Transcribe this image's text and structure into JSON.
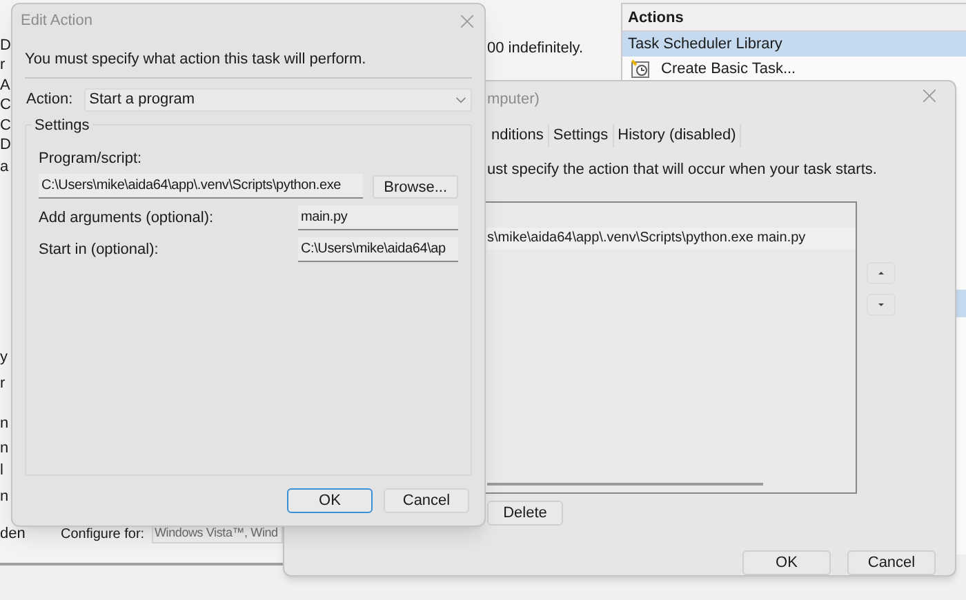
{
  "background_window": {
    "left_fragments": [
      "D",
      "r",
      "A",
      "C",
      "C",
      "D",
      "a",
      "y",
      "r",
      "n",
      "n",
      "l",
      "n"
    ],
    "status_text": "00 indefinitely.",
    "bottom_label": "den",
    "configure_for": {
      "label": "Configure for:",
      "value": "Windows Vista™, Wind"
    }
  },
  "actions_pane": {
    "title": "Actions",
    "items": [
      {
        "label": "Task Scheduler Library",
        "kind": "header",
        "selected": true
      },
      {
        "label": "Create Basic Task...",
        "kind": "action",
        "selected": false
      }
    ]
  },
  "create_task": {
    "title": "mputer)",
    "tabs": [
      {
        "label": "nditions",
        "selected": false
      },
      {
        "label": "Settings",
        "selected": false
      },
      {
        "label": "History (disabled)",
        "selected": false
      }
    ],
    "instruction": "ust specify the action that will occur when your task starts.",
    "rows": [
      {
        "details": "s\\mike\\aida64\\app\\.venv\\Scripts\\python.exe main.py"
      }
    ],
    "delete_button": "Delete",
    "buttons": [
      "OK",
      "Cancel"
    ]
  },
  "edit_action": {
    "title": "Edit Action",
    "instruction": "You must specify what action this task will perform.",
    "action": {
      "label": "Action:",
      "value": "Start a program"
    },
    "settings_label": "Settings",
    "program": {
      "label": "Program/script:",
      "value": "C:\\Users\\mike\\aida64\\app\\.venv\\Scripts\\python.exe"
    },
    "browse_button": "Browse...",
    "arguments": {
      "label": "Add arguments (optional):",
      "value": "main.py"
    },
    "start_in": {
      "label": "Start in (optional):",
      "value": "C:\\Users\\mike\\aida64\\ap"
    },
    "buttons": [
      {
        "label": "OK",
        "default": true
      },
      {
        "label": "Cancel",
        "default": false
      }
    ]
  }
}
